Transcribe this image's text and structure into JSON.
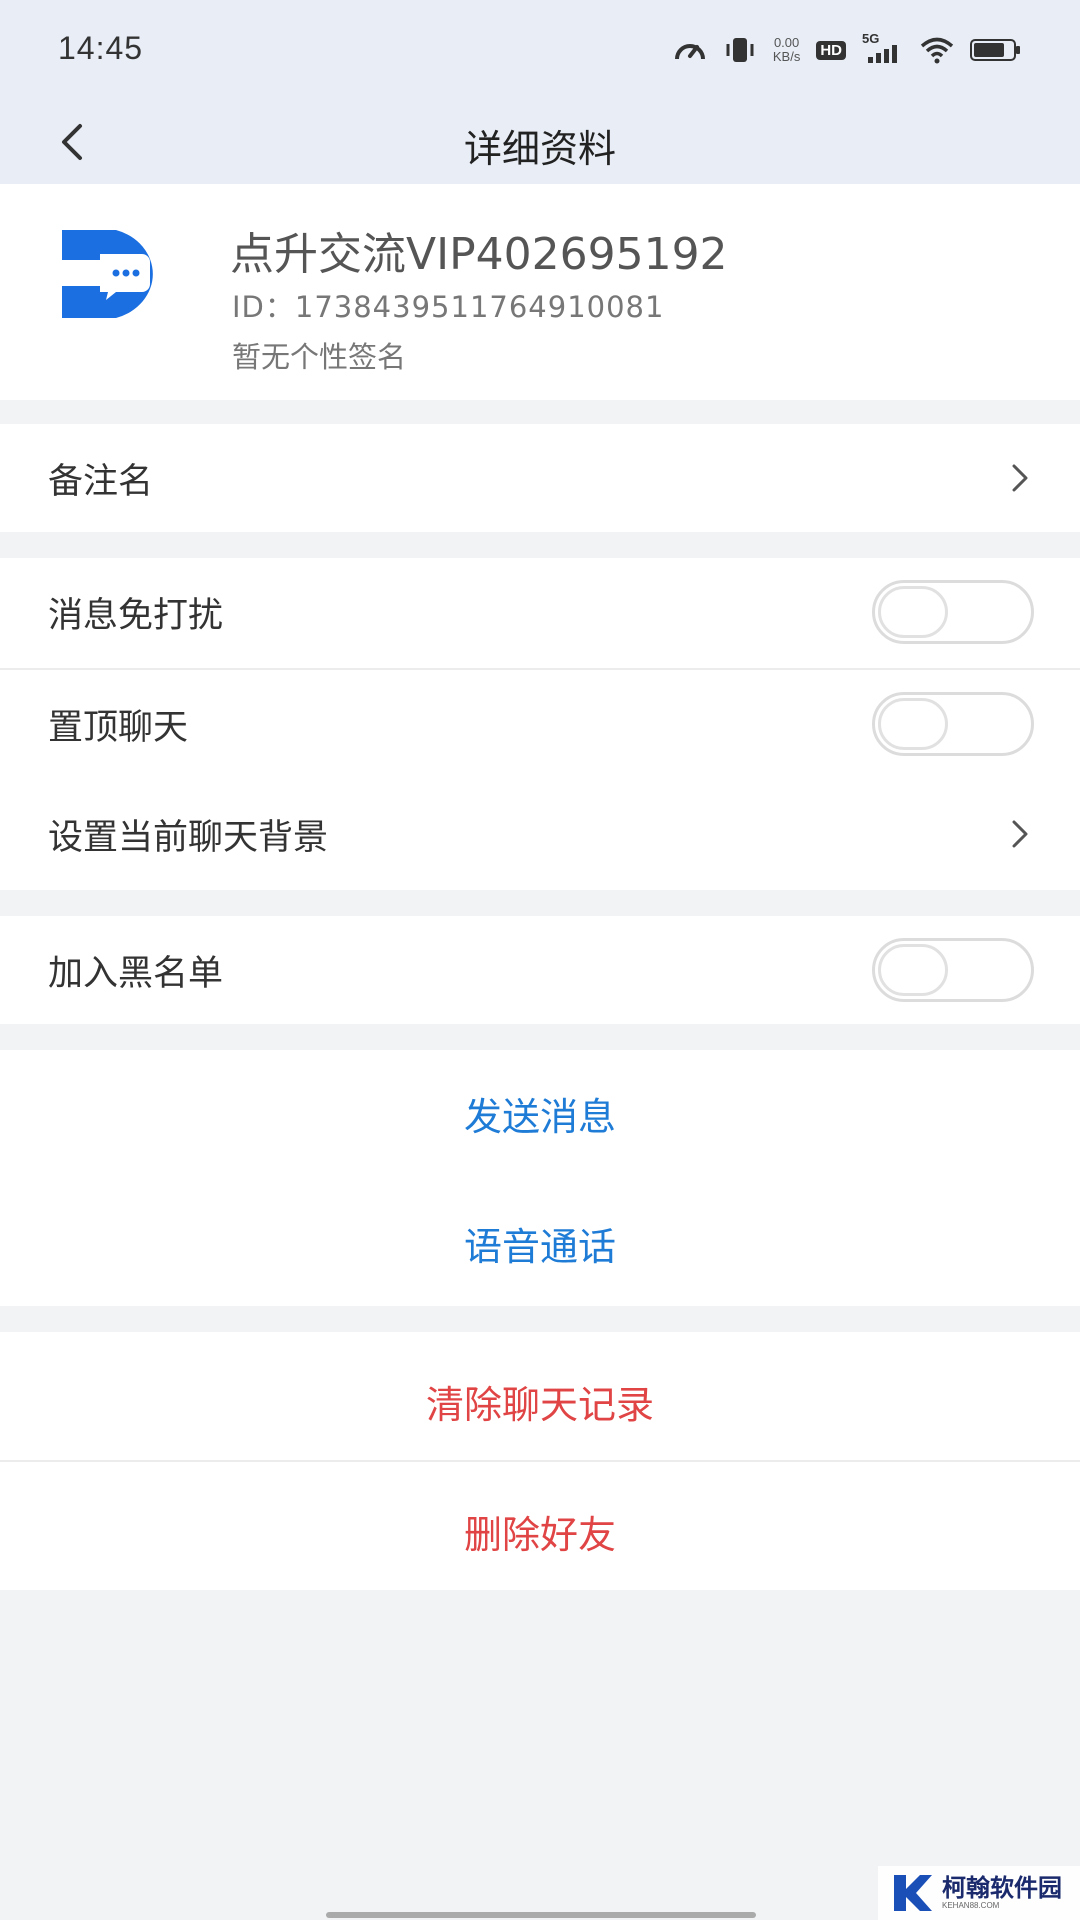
{
  "status_bar": {
    "time": "14:45",
    "net_speed_value": "0.00",
    "net_speed_unit": "KB/s",
    "hd_label": "HD",
    "network_type": "5G",
    "icons": [
      "speedometer-icon",
      "vibrate-icon",
      "signal-icon",
      "wifi-icon",
      "battery-icon"
    ]
  },
  "nav": {
    "title": "详细资料",
    "back_icon": "chevron-left-icon"
  },
  "profile": {
    "name": "点升交流VIP402695192",
    "id_text": "ID：1738439511764910081",
    "signature": "暂无个性签名",
    "avatar_color": "#1c6fe0"
  },
  "settings": {
    "remark_label": "备注名",
    "mute_label": "消息免打扰",
    "mute_on": false,
    "pin_label": "置顶聊天",
    "pin_on": false,
    "background_label": "设置当前聊天背景",
    "blacklist_label": "加入黑名单",
    "blacklist_on": false
  },
  "actions": {
    "send_message": "发送消息",
    "voice_call": "语音通话",
    "clear_history": "清除聊天记录",
    "delete_friend": "删除好友"
  },
  "colors": {
    "primary_blue": "#1e7bd6",
    "danger_red": "#e04444",
    "header_bg": "#e8edf6",
    "page_bg": "#f2f3f5"
  },
  "watermark": {
    "cn": "柯翰软件园",
    "en": "KEHAN88.COM"
  }
}
